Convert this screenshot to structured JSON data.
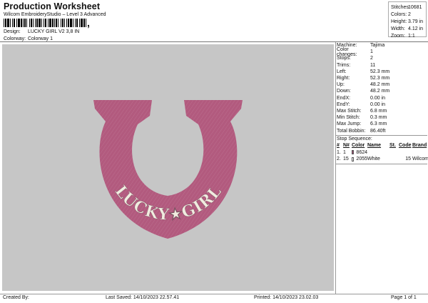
{
  "header": {
    "title": "Production Worksheet",
    "subtitle": "Wilcom EmbroideryStudio – Level 3 Advanced",
    "barcode_suffix": ","
  },
  "meta": {
    "design_label": "Design:",
    "design_value": "LUCKY GIRL V2 3,8 IN",
    "colorway_label": "Colorway:",
    "colorway_value": "Colorway 1"
  },
  "stats": [
    {
      "label": "Stitches:",
      "value": "10681"
    },
    {
      "label": "Colors:",
      "value": "2"
    },
    {
      "label": "Height:",
      "value": "3.79 in"
    },
    {
      "label": "Width:",
      "value": "4.12 in"
    },
    {
      "label": "Zoom:",
      "value": "1:1"
    }
  ],
  "design_image": {
    "text_left": "LUCKY",
    "text_right": "GIRL",
    "star": "★",
    "thread_color": "#b25a7e",
    "text_color": "#f0ecdf"
  },
  "machine_info": [
    {
      "label": "Machine:",
      "value": "Tajima"
    },
    {
      "label": "Color changes:",
      "value": "1"
    },
    {
      "label": "Stops:",
      "value": "2"
    },
    {
      "label": "Trims:",
      "value": "11"
    },
    {
      "label": "Left:",
      "value": "52.3 mm"
    },
    {
      "label": "Right:",
      "value": "52.3 mm"
    },
    {
      "label": "Up:",
      "value": "48.2 mm"
    },
    {
      "label": "Down:",
      "value": "48.2 mm"
    },
    {
      "label": "EndX:",
      "value": "0.00 in"
    },
    {
      "label": "EndY:",
      "value": "0.00 in"
    },
    {
      "label": "Max Stitch:",
      "value": "6.8 mm"
    },
    {
      "label": "Min Stitch:",
      "value": "0.3 mm"
    },
    {
      "label": "Max Jump:",
      "value": "6.3 mm"
    },
    {
      "label": "Total Bobbin:",
      "value": "86.40ft"
    }
  ],
  "stop_sequence": {
    "title": "Stop Sequence:",
    "columns": [
      "#",
      "N#",
      "Color",
      "Name",
      "St.",
      "Code",
      "Brand"
    ],
    "rows": [
      {
        "num": "1.",
        "needle": "1",
        "color": "#a04a70",
        "code_text": "8624",
        "name": "",
        "st": "",
        "code": "",
        "brand": ""
      },
      {
        "num": "2.",
        "needle": "15",
        "color": "#ffffff",
        "code_text": "2055",
        "name": "White",
        "st": "",
        "code": "15",
        "brand": "Wilcom"
      }
    ]
  },
  "footer": {
    "created_by": "Created By:",
    "last_saved": "Last Saved: 14/10/2023 22.57.41",
    "printed": "Printed: 14/10/2023 23.02.03",
    "page": "Page 1 of 1"
  }
}
